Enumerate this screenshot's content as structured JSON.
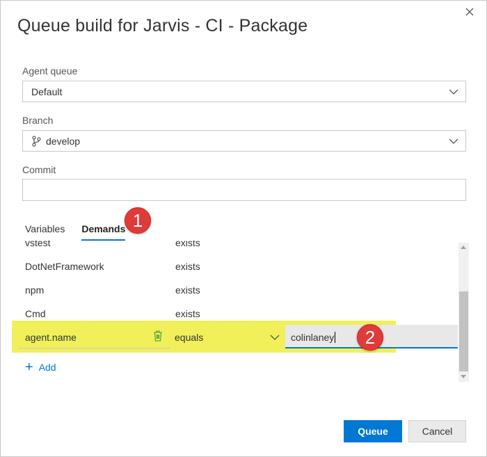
{
  "dialog": {
    "title": "Queue build for Jarvis - CI - Package",
    "close_icon": "close-icon"
  },
  "agent_queue": {
    "label": "Agent queue",
    "value": "Default"
  },
  "branch": {
    "label": "Branch",
    "value": "develop",
    "icon": "branch-icon"
  },
  "commit": {
    "label": "Commit",
    "value": ""
  },
  "tabs": [
    {
      "label": "Variables",
      "active": false
    },
    {
      "label": "Demands",
      "active": true
    }
  ],
  "annotations": {
    "badge1": "1",
    "badge2": "2",
    "color": "#e03b3b",
    "highlight_color": "#f1f05a"
  },
  "demands": [
    {
      "name": "vstest",
      "condition": "exists"
    },
    {
      "name": "DotNetFramework",
      "condition": "exists"
    },
    {
      "name": "npm",
      "condition": "exists"
    },
    {
      "name": "Cmd",
      "condition": "exists"
    }
  ],
  "edit_demand": {
    "name": "agent.name",
    "condition": "equals",
    "value": "colinlaney"
  },
  "add_label": "Add",
  "buttons": {
    "queue": "Queue",
    "cancel": "Cancel"
  },
  "colors": {
    "accent": "#0078d4"
  }
}
